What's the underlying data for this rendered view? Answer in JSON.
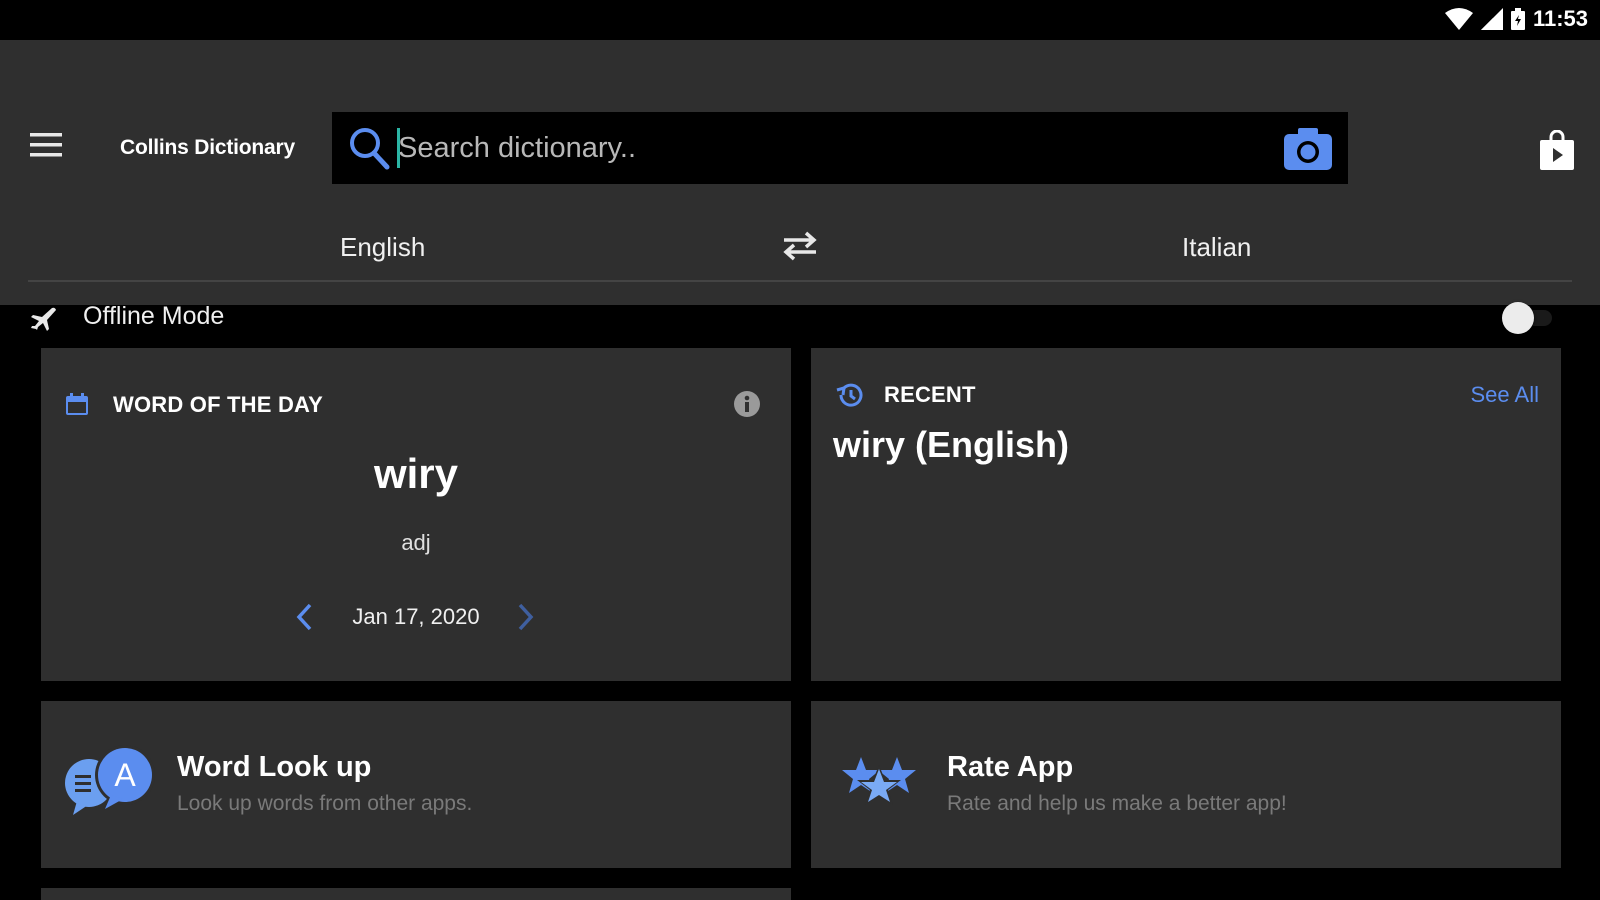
{
  "status_bar": {
    "time": "11:53"
  },
  "app_bar": {
    "title": "Collins Dictionary",
    "search": {
      "placeholder": "Search dictionary..",
      "value": ""
    }
  },
  "languages": {
    "from": "English",
    "to": "Italian"
  },
  "offline": {
    "label": "Offline Mode",
    "enabled": false
  },
  "word_of_the_day": {
    "title": "WORD OF THE DAY",
    "word": "wiry",
    "part_of_speech": "adj",
    "date": "Jan 17, 2020"
  },
  "recent": {
    "title": "RECENT",
    "see_all": "See All",
    "items": [
      "wiry (English)"
    ]
  },
  "features": {
    "lookup": {
      "title": "Word Look up",
      "subtitle": "Look up words from other apps."
    },
    "rate": {
      "title": "Rate App",
      "subtitle": "Rate and help us make a better app!"
    }
  },
  "colors": {
    "accent": "#5b8def",
    "surface": "#2f2f2f",
    "background": "#000000"
  }
}
